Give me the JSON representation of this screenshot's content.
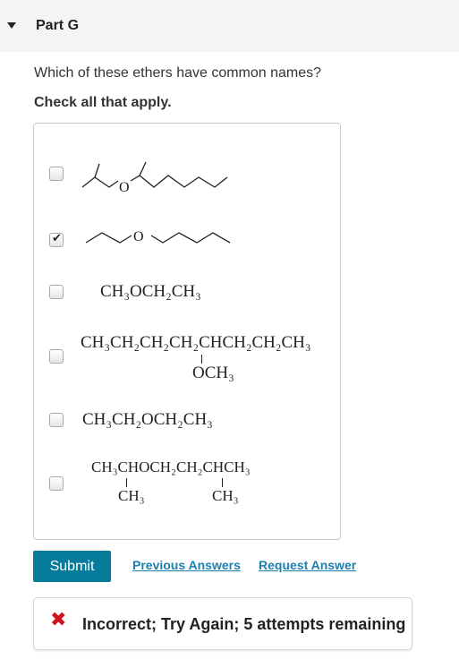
{
  "part": {
    "title": "Part G"
  },
  "question": {
    "text": "Which of these ethers have common names?",
    "instruction": "Check all that apply."
  },
  "options": [
    {
      "checked": false,
      "type": "skeletal-structure",
      "atom_label": "O"
    },
    {
      "checked": true,
      "type": "skeletal-structure",
      "atom_label": "O"
    },
    {
      "checked": false,
      "formula": "CH₃OCH₂CH₃"
    },
    {
      "checked": false,
      "formula": "CH₃CH₂CH₂CH₂CHCH₂CH₂CH₃",
      "substituent": "OCH₃"
    },
    {
      "checked": false,
      "formula": "CH₃CH₂OCH₂CH₃"
    },
    {
      "checked": false,
      "formula": "CH₃CHOCH₂CH₂CHCH₃",
      "substituents": [
        "CH₃",
        "CH₃"
      ]
    }
  ],
  "actions": {
    "submit": "Submit",
    "previous_answers": "Previous Answers",
    "request_answer": "Request Answer"
  },
  "feedback": {
    "icon": "x-icon",
    "color": "#d0131c",
    "text": "Incorrect; Try Again; 5 attempts remaining"
  },
  "colors": {
    "accent": "#077b9a",
    "link": "#1d7fae"
  }
}
